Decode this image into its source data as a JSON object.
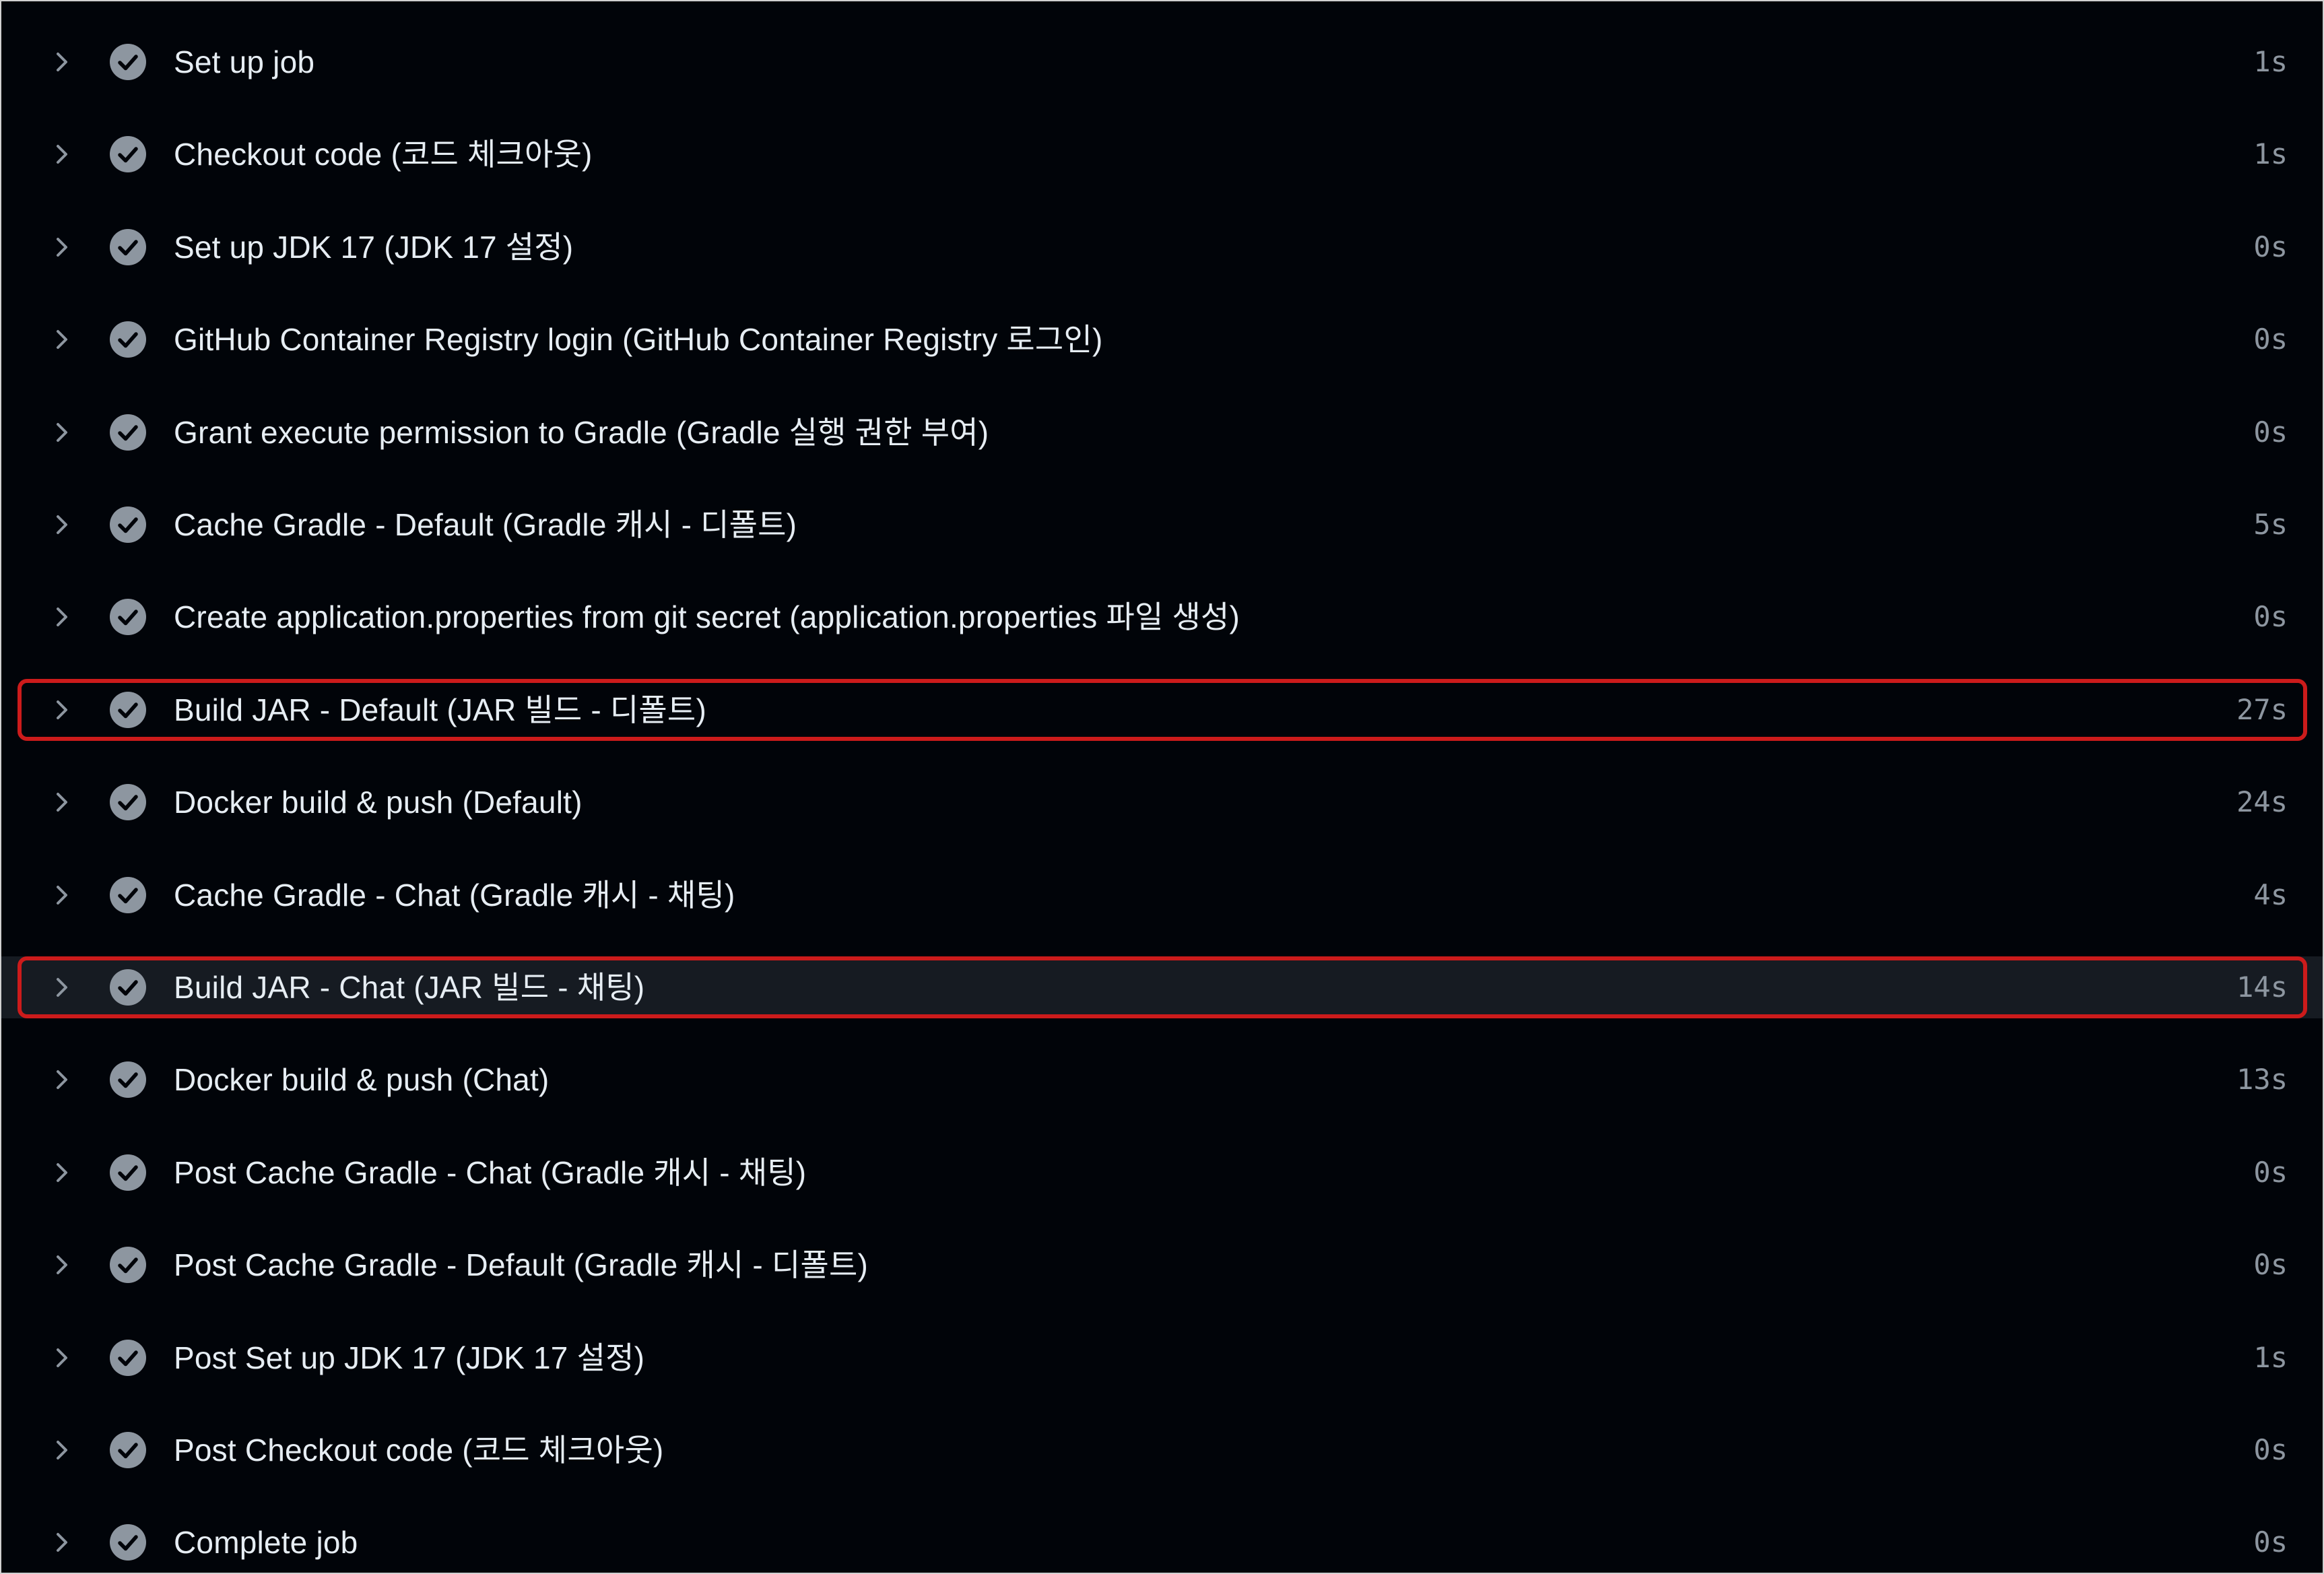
{
  "icons": {
    "expand": "chevron-right-icon",
    "status": "check-circle-fill-icon"
  },
  "colors": {
    "background": "#010409",
    "hover_row": "#161b22",
    "text": "#e6edf3",
    "muted": "#8d96a0",
    "check_fill": "#8d96a0",
    "highlight_border": "#cc1b1b"
  },
  "steps": [
    {
      "name": "Set up job",
      "duration": "1s",
      "status": "success"
    },
    {
      "name": "Checkout code (코드 체크아웃)",
      "duration": "1s",
      "status": "success"
    },
    {
      "name": "Set up JDK 17 (JDK 17 설정)",
      "duration": "0s",
      "status": "success"
    },
    {
      "name": "GitHub Container Registry login (GitHub Container Registry 로그인)",
      "duration": "0s",
      "status": "success"
    },
    {
      "name": "Grant execute permission to Gradle (Gradle 실행 권한 부여)",
      "duration": "0s",
      "status": "success"
    },
    {
      "name": "Cache Gradle - Default (Gradle 캐시 - 디폴트)",
      "duration": "5s",
      "status": "success"
    },
    {
      "name": "Create application.properties from git secret (application.properties 파일 생성)",
      "duration": "0s",
      "status": "success"
    },
    {
      "name": "Build JAR - Default (JAR 빌드 - 디폴트)",
      "duration": "27s",
      "status": "success",
      "highlighted": true
    },
    {
      "name": "Docker build & push (Default)",
      "duration": "24s",
      "status": "success"
    },
    {
      "name": "Cache Gradle - Chat (Gradle 캐시 - 채팅)",
      "duration": "4s",
      "status": "success"
    },
    {
      "name": "Build JAR - Chat (JAR 빌드 - 채팅)",
      "duration": "14s",
      "status": "success",
      "highlighted": true,
      "hovered": true
    },
    {
      "name": "Docker build & push (Chat)",
      "duration": "13s",
      "status": "success"
    },
    {
      "name": "Post Cache Gradle - Chat (Gradle 캐시 - 채팅)",
      "duration": "0s",
      "status": "success"
    },
    {
      "name": "Post Cache Gradle - Default (Gradle 캐시 - 디폴트)",
      "duration": "0s",
      "status": "success"
    },
    {
      "name": "Post Set up JDK 17 (JDK 17 설정)",
      "duration": "1s",
      "status": "success"
    },
    {
      "name": "Post Checkout code (코드 체크아웃)",
      "duration": "0s",
      "status": "success"
    },
    {
      "name": "Complete job",
      "duration": "0s",
      "status": "success"
    }
  ]
}
